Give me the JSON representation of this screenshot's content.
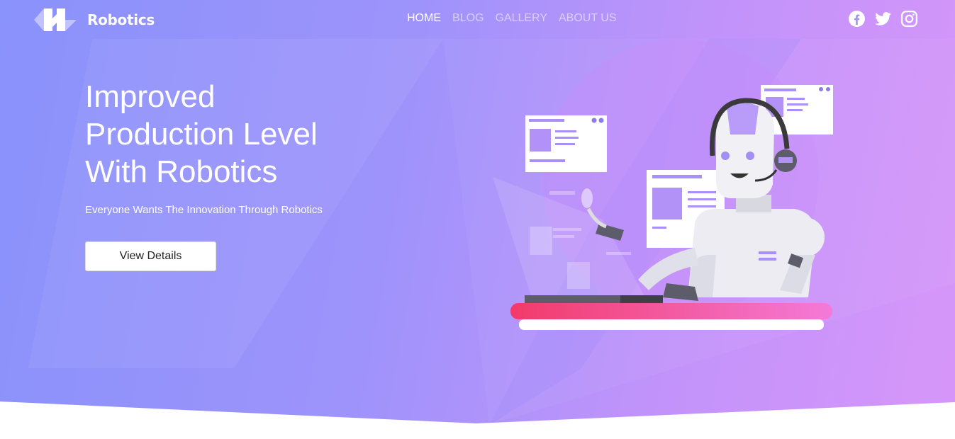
{
  "brand": {
    "name": "Robotics",
    "logo_icon": "logo-mark-icon"
  },
  "nav": {
    "items": [
      {
        "label": "HOME",
        "active": true
      },
      {
        "label": "BLOG",
        "active": false
      },
      {
        "label": "GALLERY",
        "active": false
      },
      {
        "label": "ABOUT US",
        "active": false
      }
    ]
  },
  "social": [
    "facebook-icon",
    "twitter-icon",
    "instagram-icon"
  ],
  "hero": {
    "headline_line1": "Improved",
    "headline_line2": "Production Level",
    "headline_line3": "With Robotics",
    "subtitle": "Everyone Wants The Innovation Through Robotics",
    "cta_label": "View Details"
  },
  "colors": {
    "gradient_start": "#8a92fb",
    "gradient_end": "#d796f9",
    "desk_pink": "#f23a6a",
    "desk_light_pink": "#f47ad8"
  }
}
